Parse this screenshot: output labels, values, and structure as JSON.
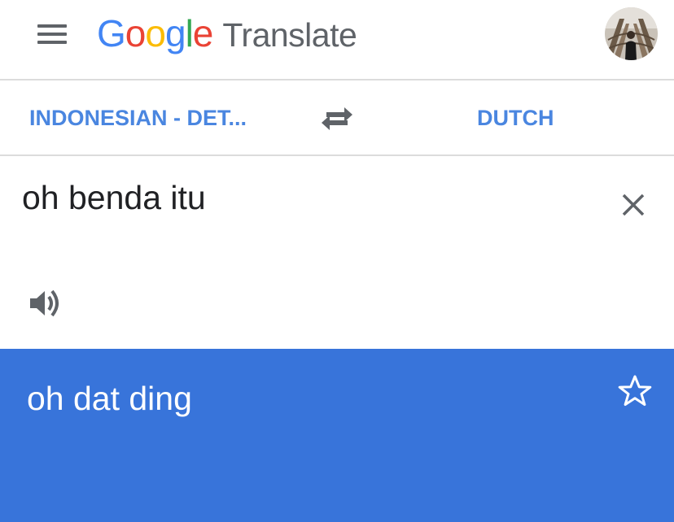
{
  "header": {
    "brand": {
      "letters": [
        {
          "char": "G",
          "color": "#4285f4"
        },
        {
          "char": "o",
          "color": "#ea4335"
        },
        {
          "char": "o",
          "color": "#fbbc05"
        },
        {
          "char": "g",
          "color": "#4285f4"
        },
        {
          "char": "l",
          "color": "#34a853"
        },
        {
          "char": "e",
          "color": "#ea4335"
        }
      ]
    },
    "product": "Translate",
    "menu_icon": "menu-icon",
    "avatar_icon": "user-avatar"
  },
  "languages": {
    "source": "INDONESIAN - DET...",
    "target": "DUTCH",
    "swap_icon": "swap-arrows-icon"
  },
  "input": {
    "text": "oh benda itu",
    "clear_icon": "close-icon",
    "speaker_icon": "speaker-icon"
  },
  "result": {
    "text": "oh dat ding",
    "star_icon": "star-outline-icon"
  },
  "colors": {
    "accent": "#4a86e0",
    "result_background": "#3874da",
    "icon_gray": "#5f6368",
    "text": "#202124"
  }
}
